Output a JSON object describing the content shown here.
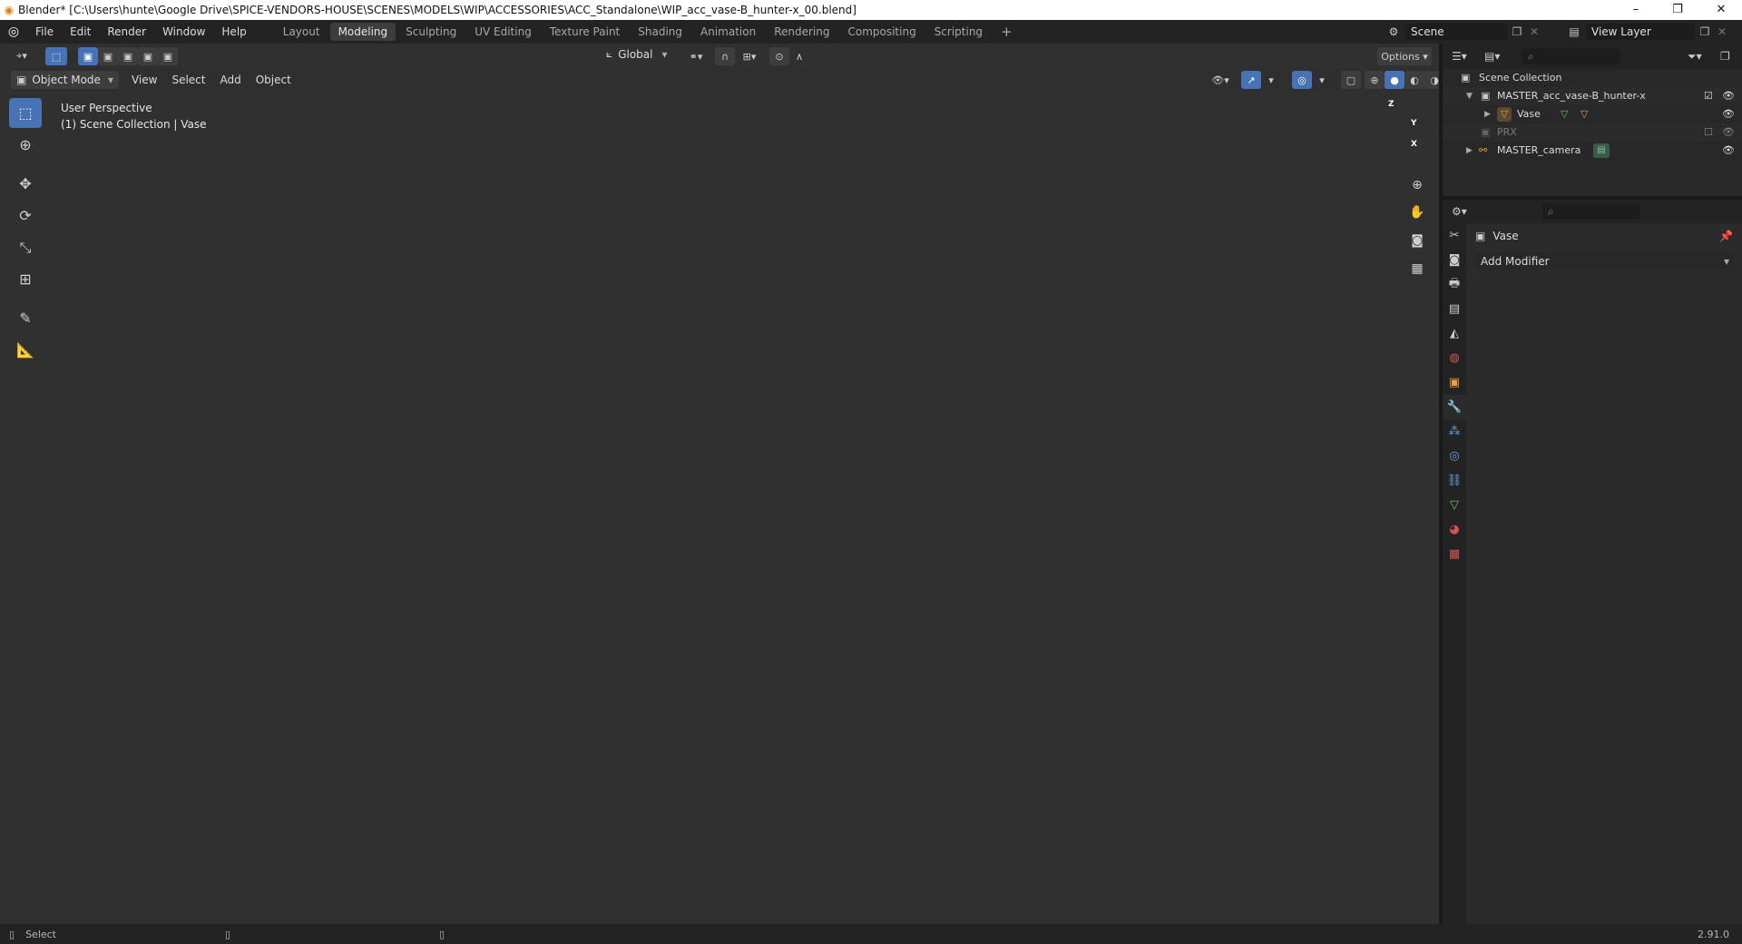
{
  "window": {
    "title": "Blender* [C:\\Users\\hunte\\Google Drive\\SPICE-VENDORS-HOUSE\\SCENES\\MODELS\\WIP\\ACCESSORIES\\ACC_Standalone\\WIP_acc_vase-B_hunter-x_00.blend]",
    "minimize": "–",
    "restore": "❐",
    "close": "✕"
  },
  "menu": {
    "items": [
      "File",
      "Edit",
      "Render",
      "Window",
      "Help"
    ]
  },
  "workspaces": {
    "tabs": [
      "Layout",
      "Modeling",
      "Sculpting",
      "UV Editing",
      "Texture Paint",
      "Shading",
      "Animation",
      "Rendering",
      "Compositing",
      "Scripting"
    ],
    "active": "Modeling",
    "add": "+"
  },
  "scene": {
    "name": "Scene",
    "view_layer": "View Layer"
  },
  "toolhead": {
    "orientation": "Global",
    "options": "Options"
  },
  "viewport_header": {
    "mode": "Object Mode",
    "menus": [
      "View",
      "Select",
      "Add",
      "Object"
    ]
  },
  "viewport": {
    "perspective": "User Perspective",
    "collection": "(1) Scene Collection | Vase",
    "gizmo": {
      "x": "X",
      "y": "Y",
      "z": "Z"
    },
    "colors": {
      "x_axis": "#b8404a",
      "y_axis": "#6a9b2a",
      "z_axis": "#3f7fd6",
      "bg": "#3d3d3d"
    }
  },
  "outliner": {
    "root": "Scene Collection",
    "items": [
      {
        "label": "MASTER_acc_vase-B_hunter-x",
        "depth": 1
      },
      {
        "label": "Vase",
        "depth": 2
      },
      {
        "label": "PRX",
        "depth": 1
      },
      {
        "label": "MASTER_camera",
        "depth": 1
      }
    ]
  },
  "properties": {
    "object": "Vase",
    "add_modifier": "Add Modifier"
  },
  "status": {
    "left": "Select",
    "version": "2.91.0"
  }
}
